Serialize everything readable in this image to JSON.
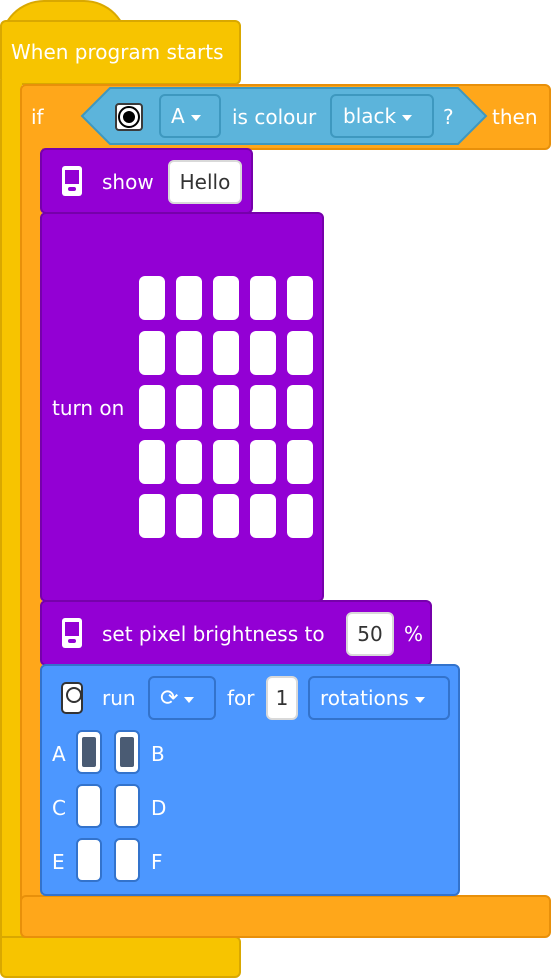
{
  "hat_block": {
    "label": "When program starts"
  },
  "if_block": {
    "if_label": "if",
    "then_label": "then",
    "condition": {
      "sensor_icon": "color-sensor-icon",
      "port": "A",
      "is_colour_label": "is colour",
      "colour": "black",
      "question": "?"
    }
  },
  "show_block": {
    "label": "show",
    "value": "Hello",
    "icon": "hub-display-icon"
  },
  "turn_on_block": {
    "label": "turn on",
    "rows": 5,
    "cols": 5
  },
  "brightness_block": {
    "label": "set pixel brightness to",
    "value": "50",
    "unit": "%",
    "icon": "hub-display-icon"
  },
  "motor_block": {
    "icon": "motor-pair-icon",
    "run_label": "run",
    "direction_icon": "rotate-clockwise-icon",
    "for_label": "for",
    "amount": "1",
    "unit": "rotations",
    "ports": [
      {
        "label": "A",
        "on": true
      },
      {
        "label": "B",
        "on": true
      },
      {
        "label": "C",
        "on": false
      },
      {
        "label": "D",
        "on": false
      },
      {
        "label": "E",
        "on": false
      },
      {
        "label": "F",
        "on": false
      }
    ]
  },
  "colors": {
    "events": "#f7c400",
    "control": "#ffa71a",
    "sensors": "#5cb4db",
    "display": "#9300d4",
    "motors": "#4c97ff"
  }
}
